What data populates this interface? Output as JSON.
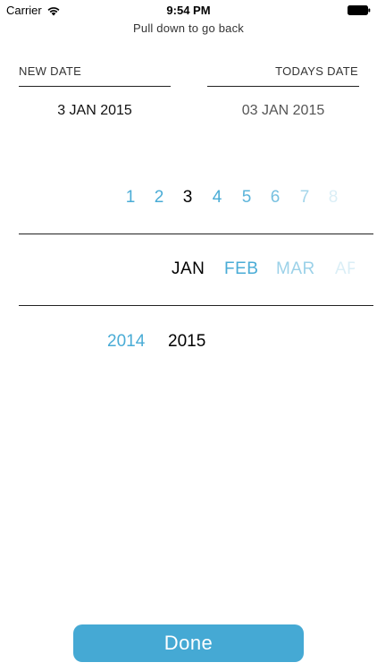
{
  "status_bar": {
    "carrier": "Carrier",
    "time": "9:54 PM",
    "wifi_icon": "wifi-icon",
    "battery_icon": "battery-icon"
  },
  "pull_hint": "Pull down to go back",
  "dates": {
    "new_date_label": "NEW DATE",
    "todays_date_label": "TODAYS DATE",
    "new_date_value": "3 JAN 2015",
    "todays_date_value": "03 JAN 2015"
  },
  "day_picker": {
    "days": [
      "1",
      "2",
      "3",
      "4",
      "5",
      "6",
      "7",
      "8"
    ],
    "selected": "3"
  },
  "month_picker": {
    "months": [
      "JAN",
      "FEB",
      "MAR",
      "AP"
    ],
    "selected": "JAN"
  },
  "year_picker": {
    "years": [
      "2014",
      "2015"
    ],
    "selected": "2015"
  },
  "done_button": {
    "label": "Done"
  },
  "colors": {
    "accent": "#45a9d4",
    "picker_text": "#4aacd6",
    "selected_text": "#000000"
  }
}
